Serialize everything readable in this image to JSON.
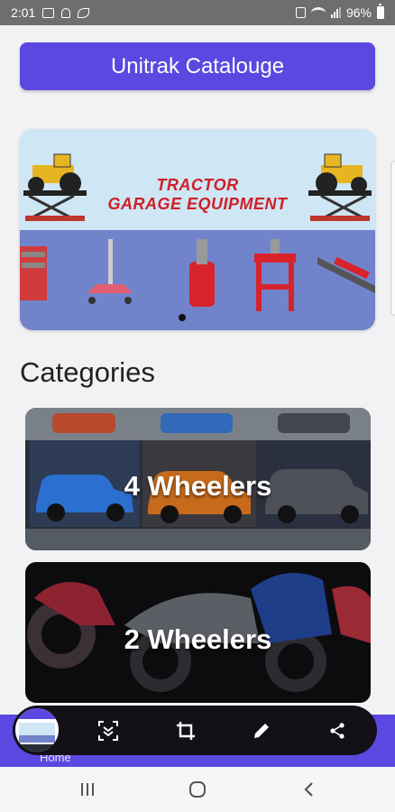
{
  "status_bar": {
    "time": "2:01",
    "battery": "96%",
    "left_icons": [
      "image-icon",
      "person-icon",
      "leaf-icon"
    ],
    "right_icons": [
      "nfc-icon",
      "wifi-icon",
      "signal-icon",
      "battery-icon"
    ]
  },
  "header": {
    "title": "Unitrak Catalouge"
  },
  "banner": {
    "line1": "TRACTOR",
    "line2": "GARAGE EQUIPMENT",
    "slide_count": 1,
    "active_slide": 1
  },
  "categories": {
    "title": "Categories",
    "items": [
      {
        "label": "4 Wheelers"
      },
      {
        "label": "2 Wheelers"
      }
    ]
  },
  "bottom_nav": {
    "home_label": "Home"
  },
  "screenshot_toolbar": {
    "icons": [
      "scroll-capture-icon",
      "crop-icon",
      "edit-icon",
      "share-icon"
    ]
  },
  "system_nav": {
    "icons": [
      "recents-icon",
      "home-icon",
      "back-icon"
    ]
  },
  "colors": {
    "primary": "#5b48e0",
    "banner_title": "#d01f26",
    "banner_top": "#cfe6f4",
    "banner_bottom": "#7183cb",
    "status_bar": "#6e6e6e"
  }
}
